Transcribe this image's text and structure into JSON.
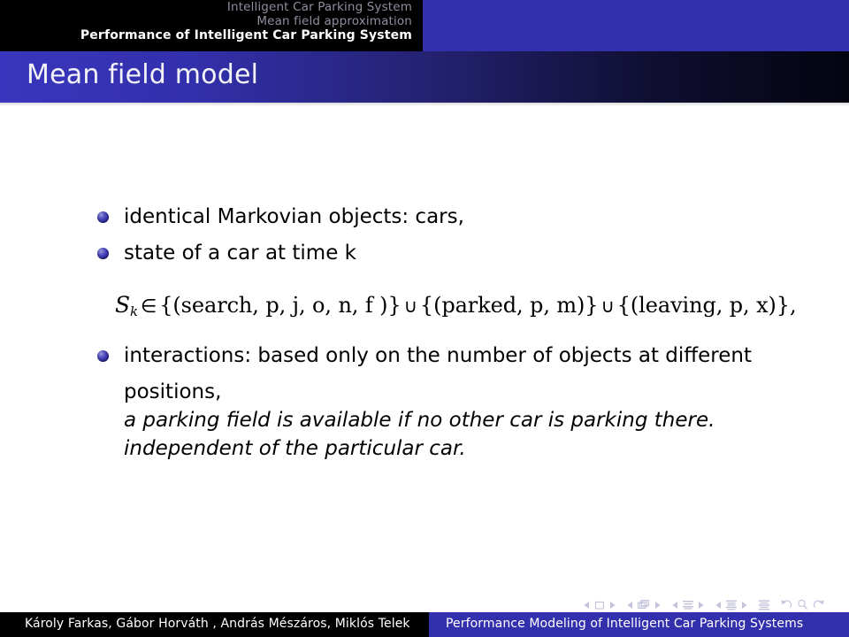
{
  "header": {
    "nav_lines": [
      {
        "label": "Intelligent Car Parking System",
        "active": false
      },
      {
        "label": "Mean field approximation",
        "active": false
      },
      {
        "label": "Performance of Intelligent Car Parking System",
        "active": true
      }
    ],
    "frame_title": "Mean field model"
  },
  "colors": {
    "accent_blue": "#3330ad",
    "nav_bar_black": "#000000",
    "title_gradient_start": "#3a36bd",
    "title_gradient_end": "#040410",
    "bullet_blue": "#4b49bc",
    "nav_symbol_gray": "#b9b9d6"
  },
  "content": {
    "items": [
      {
        "text": "identical Markovian objects: cars,"
      },
      {
        "text_before": "state of a car at time ",
        "math_var": "k",
        "text_after": ""
      }
    ],
    "formula": {
      "lhs_symbol": "S",
      "lhs_subscript": "k",
      "element_of": "∈",
      "union": "∪",
      "terms": [
        "{(search, p, j, o, n, f )}",
        "{(parked, p, m)}",
        "{(leaving, p, x)},"
      ],
      "plain": "S_k ∈ {(search, p, j, o, n, f )} ∪ {(parked, p, m)} ∪ {(leaving, p, x)},"
    },
    "interactions": {
      "bullet_text": "interactions: based only on the number of objects at different",
      "bullet_text_line2": "positions,",
      "sub_lines": [
        "a parking field is available if no other car is parking there.",
        "independent of the particular car."
      ]
    }
  },
  "nav_symbols": [
    {
      "name": "slide-navigation",
      "icon": "square"
    },
    {
      "name": "frame-navigation",
      "icon": "frames"
    },
    {
      "name": "subsection-navigation",
      "icon": "subsection"
    },
    {
      "name": "section-navigation",
      "icon": "section"
    },
    {
      "name": "presentation-navigation",
      "icon": "doc"
    },
    {
      "name": "back-navigation",
      "icon": "back-arrow"
    },
    {
      "name": "find-navigation",
      "icon": "magnifier"
    },
    {
      "name": "forward-navigation",
      "icon": "forward-arrow"
    }
  ],
  "footer": {
    "authors": "Károly Farkas, Gábor Horváth , András Mészáros, Miklós Telek",
    "presentation_title": "Performance Modeling of Intelligent Car Parking Systems"
  }
}
